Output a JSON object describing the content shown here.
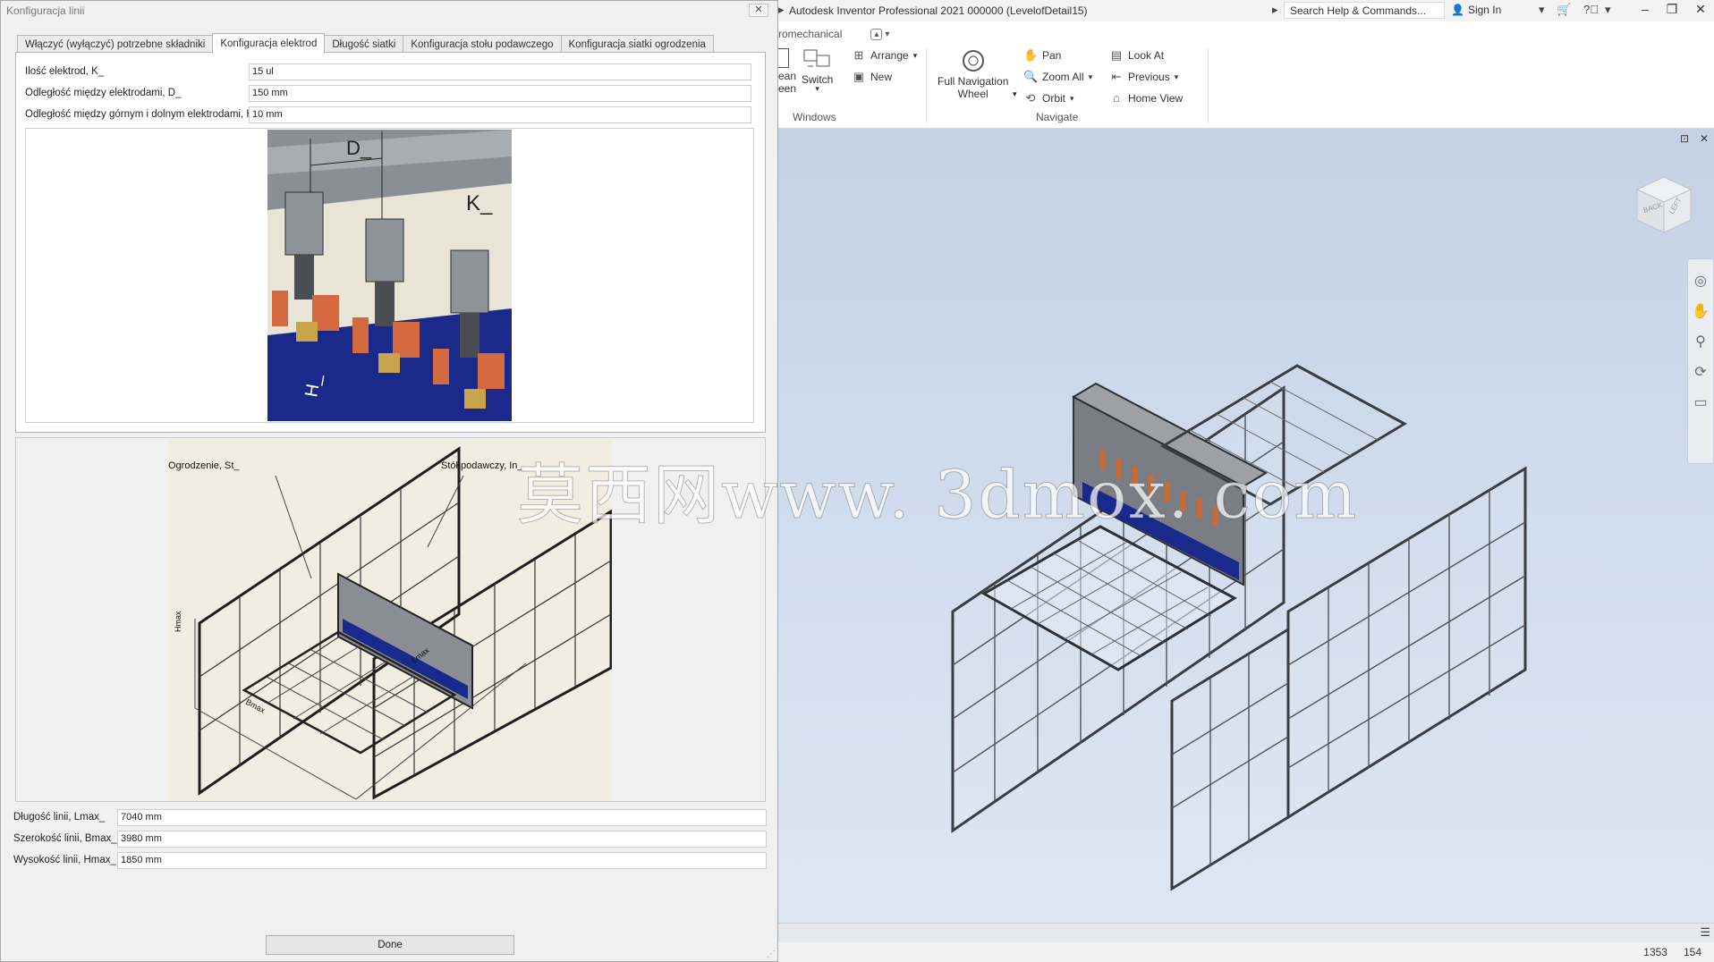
{
  "inventor": {
    "title": "Autodesk Inventor Professional 2021    000000 (LevelofDetail15)",
    "search_placeholder": "Search Help & Commands...",
    "sign_in": "Sign In",
    "ribbon_tab": "romechanical",
    "ribbon": {
      "clean_screen_partial": "ean\neen",
      "switch": "Switch",
      "arrange": "Arrange",
      "new": "New",
      "windows_panel": "Windows",
      "full_nav_wheel": "Full Navigation\nWheel",
      "pan": "Pan",
      "zoom_all": "Zoom All",
      "orbit": "Orbit",
      "look_at": "Look At",
      "previous": "Previous",
      "home_view": "Home View",
      "navigate_panel": "Navigate"
    },
    "status": {
      "left_value": "1353",
      "right_value": "154"
    }
  },
  "dialog": {
    "title": "Konfiguracja linii",
    "tabs": [
      "Włączyć (wyłączyć) potrzebne składniki",
      "Konfiguracja elektrod",
      "Długość siatki",
      "Konfiguracja stołu podawczego",
      "Konfiguracja siatki ogrodzenia"
    ],
    "active_tab_index": 1,
    "electrode_fields": [
      {
        "label": "Ilość elektrod,  K_",
        "value": "15 ul"
      },
      {
        "label": "Odległość między elektrodami,  D_",
        "value": "150 mm"
      },
      {
        "label": "Odległość między górnym i dolnym elektrodami,  H_",
        "value": "10 mm"
      }
    ],
    "electrode_picture_labels": {
      "d": "D_",
      "k": "K_",
      "h": "H_"
    },
    "line_picture_labels": {
      "fence": "Ogrodzenie,  St_",
      "table": "Stół podawczy,  In_",
      "hmax": "Hmax",
      "lmax": "Lmax",
      "bmax": "Bmax"
    },
    "line_fields": [
      {
        "label": "Długość linii,  Lmax_",
        "value": "7040 mm"
      },
      {
        "label": "Szerokość linii,  Bmax_",
        "value": "3980 mm"
      },
      {
        "label": "Wysokość linii,  Hmax_",
        "value": "1850 mm"
      }
    ],
    "done": "Done"
  },
  "watermark": "莫西网www. 3dmox. com"
}
